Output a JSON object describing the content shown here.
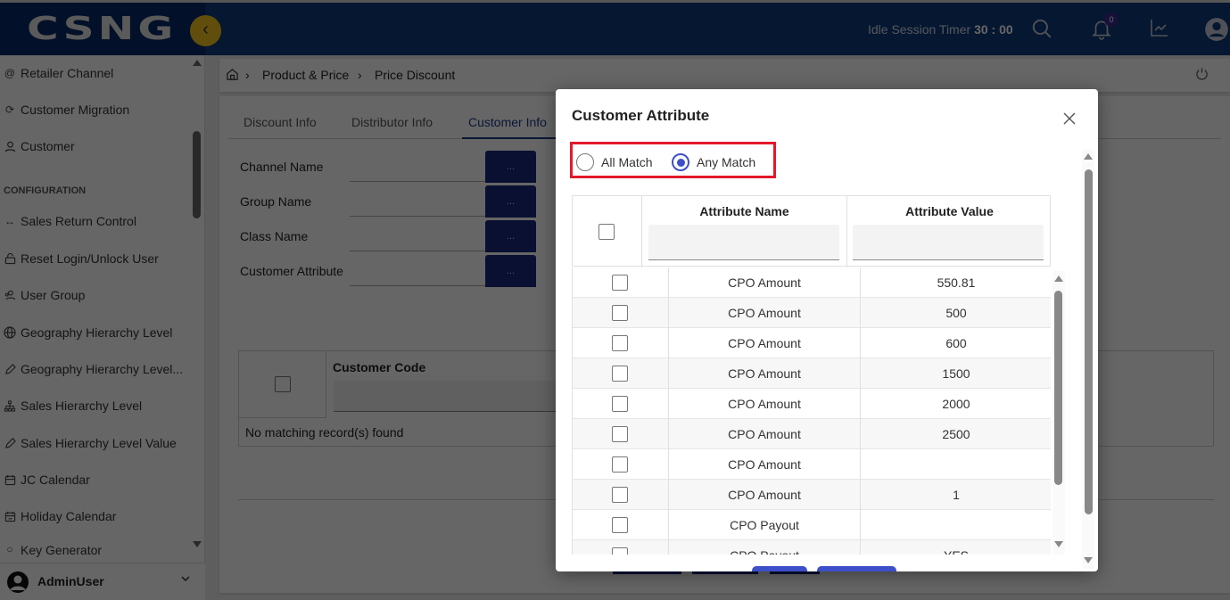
{
  "app": {
    "logo": "CSNG",
    "idle_label": "Idle Session Timer",
    "idle_value": "30 : 00",
    "notification_count": "0",
    "colors": {
      "header": "#0e3a7a",
      "logo_zone": "#072a68",
      "accent": "#f4c21f",
      "primary_btn": "#1a2a7a",
      "modal_accent": "#3d4fc9",
      "highlight_border": "#e3192b"
    }
  },
  "sidebar": {
    "items": [
      {
        "label": "Retailer Channel",
        "icon": "link-icon"
      },
      {
        "label": "Customer Migration",
        "icon": "refresh-icon"
      },
      {
        "label": "Customer",
        "icon": "person-icon"
      }
    ],
    "section_label": "CONFIGURATION",
    "config_items": [
      {
        "label": "Sales Return Control",
        "icon": "arrows-horizontal-icon"
      },
      {
        "label": "Reset Login/Unlock User",
        "icon": "lock-icon"
      },
      {
        "label": "User Group",
        "icon": "user-group-icon"
      },
      {
        "label": "Geography Hierarchy Level",
        "icon": "globe-icon"
      },
      {
        "label": "Geography Hierarchy Level...",
        "icon": "pencil-icon"
      },
      {
        "label": "Sales Hierarchy Level",
        "icon": "hierarchy-icon"
      },
      {
        "label": "Sales Hierarchy Level Value",
        "icon": "pencil-icon"
      },
      {
        "label": "JC Calendar",
        "icon": "calendar-icon"
      },
      {
        "label": "Holiday Calendar",
        "icon": "calendar-icon"
      },
      {
        "label": "Key Generator",
        "icon": "key-icon"
      }
    ],
    "user_name": "AdminUser"
  },
  "breadcrumb": {
    "items": [
      "Product & Price",
      "Price Discount"
    ]
  },
  "tabs": [
    {
      "label": "Discount Info",
      "active": false
    },
    {
      "label": "Distributor Info",
      "active": false
    },
    {
      "label": "Customer Info",
      "active": true
    }
  ],
  "form": {
    "fields": [
      {
        "label": "Channel Name",
        "value": "",
        "button": "..."
      },
      {
        "label": "Group Name",
        "value": "",
        "button": "..."
      },
      {
        "label": "Class Name",
        "value": "",
        "button": "..."
      },
      {
        "label": "Customer Attribute",
        "value": "",
        "button": "..."
      }
    ]
  },
  "customer_table": {
    "columns": [
      "Customer Code"
    ],
    "empty_message": "No matching record(s) found"
  },
  "modal": {
    "title": "Customer Attribute",
    "match_options": [
      {
        "label": "All Match",
        "selected": false
      },
      {
        "label": "Any Match",
        "selected": true
      }
    ],
    "columns": [
      "Attribute Name",
      "Attribute Value"
    ],
    "filters": {
      "name": "",
      "value": ""
    },
    "rows": [
      {
        "name": "CPO Amount",
        "value": "550.81",
        "checked": false
      },
      {
        "name": "CPO Amount",
        "value": "500",
        "checked": false
      },
      {
        "name": "CPO Amount",
        "value": "600",
        "checked": false
      },
      {
        "name": "CPO Amount",
        "value": "1500",
        "checked": false
      },
      {
        "name": "CPO Amount",
        "value": "2000",
        "checked": false
      },
      {
        "name": "CPO Amount",
        "value": "2500",
        "checked": false
      },
      {
        "name": "CPO Amount",
        "value": "",
        "checked": false
      },
      {
        "name": "CPO Amount",
        "value": "1",
        "checked": false
      },
      {
        "name": "CPO Payout",
        "value": "",
        "checked": false
      },
      {
        "name": "CPO Payout",
        "value": "YES",
        "checked": false
      }
    ]
  }
}
